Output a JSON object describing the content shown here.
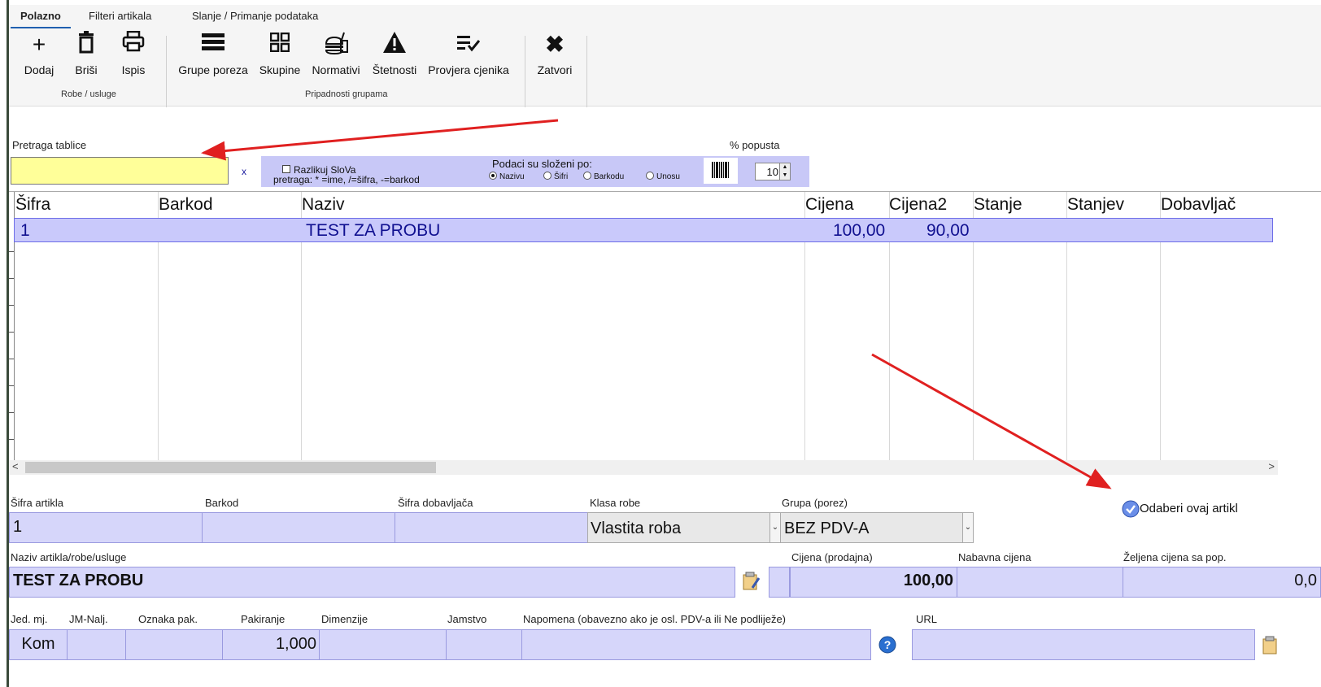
{
  "ribbon": {
    "tabs": [
      "Polazno",
      "Filteri artikala",
      "Slanje / Primanje podataka"
    ],
    "buttons": {
      "add": "Dodaj",
      "delete": "Briši",
      "print": "Ispis",
      "tax_groups": "Grupe poreza",
      "groups": "Skupine",
      "norms": "Normativi",
      "damages": "Štetnosti",
      "price_check": "Provjera cjenika",
      "close": "Zatvori"
    },
    "group_labels": {
      "goods": "Robe / usluge",
      "membership": "Pripadnosti grupama"
    }
  },
  "search": {
    "label": "Pretraga tablice",
    "value": "",
    "clear": "x",
    "case_sensitive": "Razlikuj SloVa",
    "hint": "pretraga: * =ime, /=šifra, -=barkod",
    "sort_title": "Podaci su složeni po:",
    "sort_options": [
      "Nazivu",
      "Šifri",
      "Barkodu",
      "Unosu"
    ],
    "sort_selected": "Nazivu",
    "discount_label": "% popusta",
    "discount_value": "10"
  },
  "grid": {
    "columns": [
      "Šifra",
      "Barkod",
      "Naziv",
      "Cijena",
      "Cijena2",
      "Stanje",
      "Stanjev",
      "Dobavljač"
    ],
    "rows": [
      {
        "sifra": "1",
        "barkod": "",
        "naziv": "TEST ZA PROBU",
        "cijena": "100,00",
        "cijena2": "90,00",
        "stanje": "",
        "stanjev": "",
        "dobavljac": ""
      }
    ],
    "scroll_left": "<",
    "scroll_right": ">"
  },
  "form": {
    "sifra_label": "Šifra artikla",
    "sifra_value": "1",
    "barkod_label": "Barkod",
    "barkod_value": "",
    "sifra_dob_label": "Šifra dobavljača",
    "sifra_dob_value": "",
    "klasa_label": "Klasa robe",
    "klasa_value": "Vlastita roba",
    "grupa_label": "Grupa (porez)",
    "grupa_value": "BEZ PDV-A",
    "select_button": "Odaberi ovaj artikl",
    "naziv_label": "Naziv artikla/robe/usluge",
    "naziv_value": "TEST ZA PROBU",
    "cijena_label": "Cijena (prodajna)",
    "cijena_value": "100,00",
    "nabavna_label": "Nabavna cijena",
    "nabavna_value": "",
    "zeljena_label": "Željena cijena sa pop.",
    "zeljena_value": "0,0",
    "jm_label": "Jed. mj.",
    "jm_value": "Kom",
    "jmnalj_label": "JM-Nalj.",
    "oznaka_label": "Oznaka pak.",
    "pakiranje_label": "Pakiranje",
    "pakiranje_value": "1,000",
    "dimenzije_label": "Dimenzije",
    "jamstvo_label": "Jamstvo",
    "napomena_label": "Napomena (obavezno ako je osl. PDV-a ili Ne podliježe)",
    "url_label": "URL"
  },
  "colors": {
    "accent": "#1f5fb0",
    "field_bg": "#d6d6fa",
    "search_bg": "#ffff99",
    "row_selected": "#c9c9fb",
    "annotation_arrow": "#e02020"
  }
}
